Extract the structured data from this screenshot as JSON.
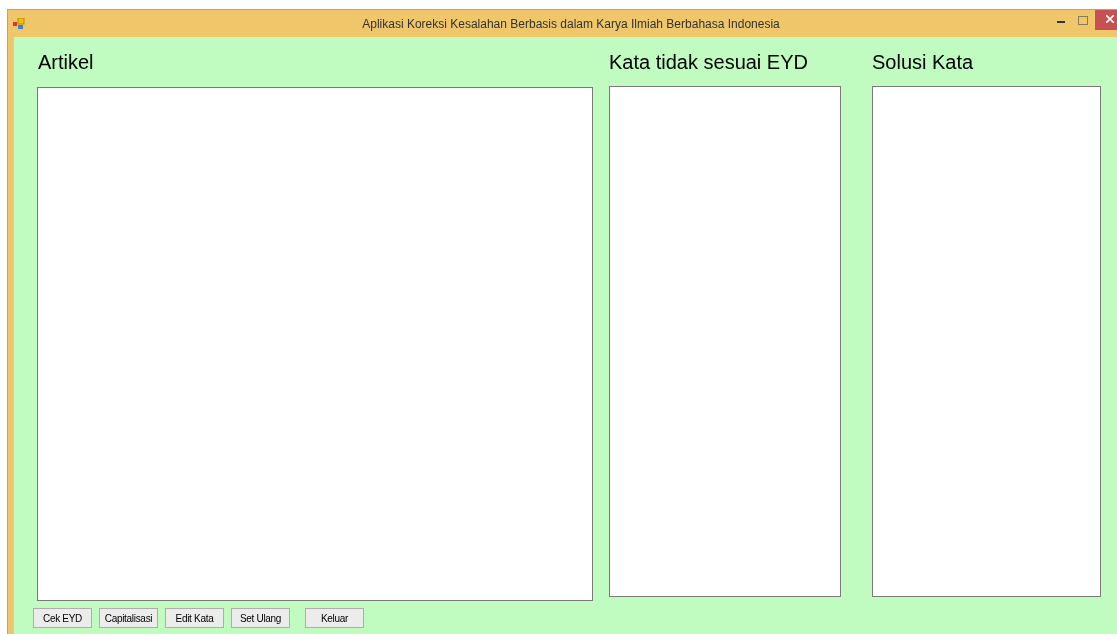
{
  "window": {
    "title": "Aplikasi Koreksi Kesalahan Berbasis dalam Karya Ilmiah Berbahasa Indonesia"
  },
  "panels": [
    {
      "heading": "Artikel"
    },
    {
      "heading": "Kata tidak sesuai EYD"
    },
    {
      "heading": "Solusi Kata"
    }
  ],
  "buttons": [
    "Cek EYD",
    "Capitalisasi",
    "Edit Kata",
    "Set Ulang",
    "Keluar"
  ]
}
